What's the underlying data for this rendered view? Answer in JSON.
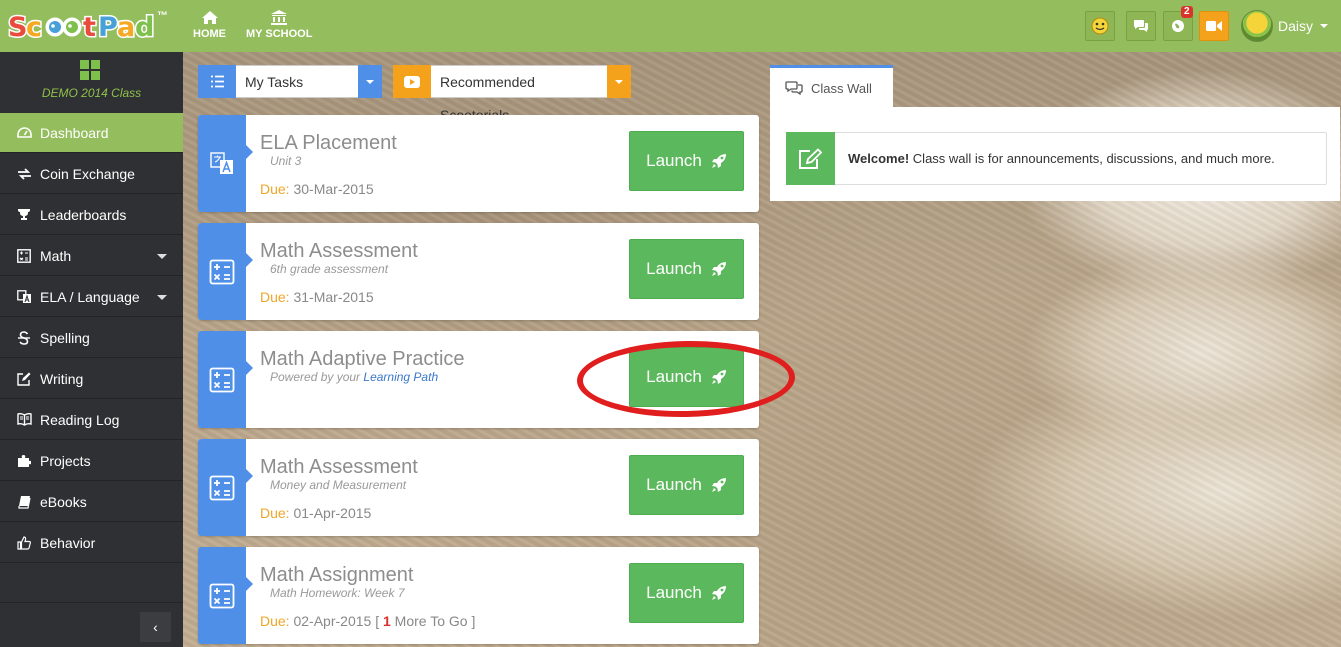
{
  "app": {
    "logo_text": "ScootPad",
    "logo_tm": "™",
    "brand_color": "#94bd5e"
  },
  "topnav": {
    "home_label": "HOME",
    "myschool_label": "MY SCHOOL",
    "notification_count": "2",
    "user_name": "Daisy"
  },
  "sidebar": {
    "class_name": "DEMO 2014 Class",
    "items": [
      {
        "label": "Dashboard",
        "icon": "dashboard-icon",
        "active": true
      },
      {
        "label": "Coin Exchange",
        "icon": "exchange-icon"
      },
      {
        "label": "Leaderboards",
        "icon": "trophy-icon"
      },
      {
        "label": "Math",
        "icon": "calculator-icon",
        "has_submenu": true
      },
      {
        "label": "ELA / Language",
        "icon": "translate-icon",
        "has_submenu": true
      },
      {
        "label": "Spelling",
        "icon": "strikethrough-icon"
      },
      {
        "label": "Writing",
        "icon": "edit-icon"
      },
      {
        "label": "Reading Log",
        "icon": "book-open-icon"
      },
      {
        "label": "Projects",
        "icon": "puzzle-icon"
      },
      {
        "label": "eBooks",
        "icon": "book-icon"
      },
      {
        "label": "Behavior",
        "icon": "thumbs-up-icon"
      }
    ],
    "collapse_glyph": "‹"
  },
  "filters": {
    "tasks_label": "My Tasks",
    "tasks_color": "#4f8fe8",
    "scootorials_label": "Recommended Scootorials",
    "scootorials_color": "#f4a11b"
  },
  "tasks": [
    {
      "title": "ELA Placement",
      "subtitle": "Unit 3",
      "due_label": "Due:",
      "due_date": "30-Mar-2015",
      "launch_label": "Launch",
      "icon": "translate-icon"
    },
    {
      "title": "Math Assessment",
      "subtitle": "6th grade assessment",
      "due_label": "Due:",
      "due_date": "31-Mar-2015",
      "launch_label": "Launch",
      "icon": "calculator-icon"
    },
    {
      "title": "Math Adaptive Practice",
      "subtitle_prefix": "Powered by your",
      "subtitle_link": "Learning Path",
      "launch_label": "Launch",
      "icon": "calculator-icon",
      "highlighted": true
    },
    {
      "title": "Math Assessment",
      "subtitle": "Money and Measurement",
      "due_label": "Due:",
      "due_date": "01-Apr-2015",
      "launch_label": "Launch",
      "icon": "calculator-icon"
    },
    {
      "title": "Math Assignment",
      "subtitle": "Math Homework: Week 7",
      "due_label": "Due:",
      "due_date": "02-Apr-2015",
      "more_open": "[",
      "more_count": "1",
      "more_text": "More To Go",
      "more_close": "]",
      "launch_label": "Launch",
      "icon": "calculator-icon"
    }
  ],
  "class_wall": {
    "tab_label": "Class Wall",
    "message_bold": "Welcome!",
    "message_text": "Class wall is for announcements, discussions, and much more."
  },
  "colors": {
    "launch_green": "#5cb85c",
    "task_blue": "#4f8fe8",
    "due_orange": "#f0a52a",
    "highlight_red": "#e01e1e"
  }
}
